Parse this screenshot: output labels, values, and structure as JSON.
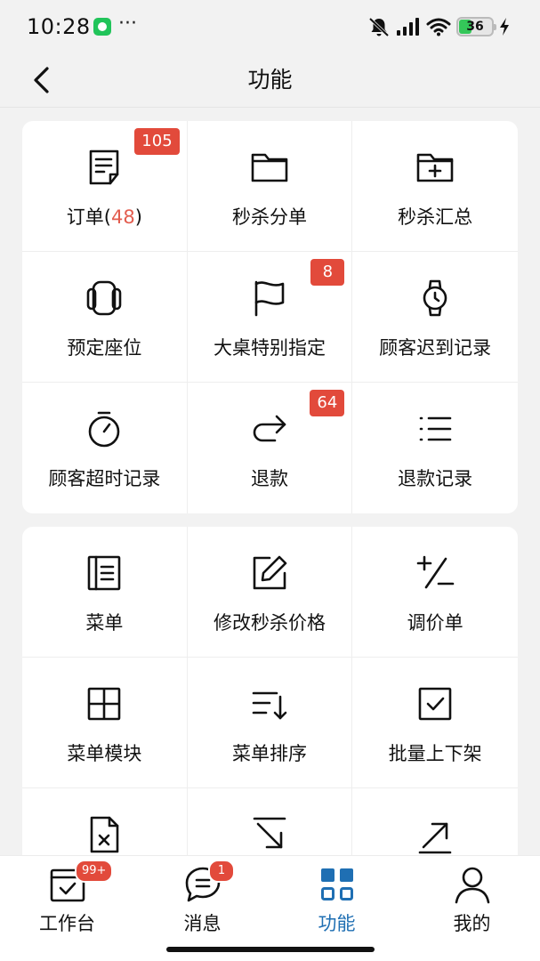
{
  "status_bar": {
    "time": "10:28",
    "dots": "···",
    "battery_level": "36",
    "icons": [
      "chat-app-icon",
      "bell-muted-icon",
      "signal-icon",
      "wifi-icon",
      "battery-icon",
      "charging-icon"
    ]
  },
  "nav": {
    "title": "功能",
    "back_icon": "chevron-left-icon"
  },
  "section1": {
    "items": [
      {
        "label": "订单(",
        "count": "48",
        "suffix": ")",
        "badge": "105",
        "icon": "order-note-icon"
      },
      {
        "label": "秒杀分单",
        "icon": "folder-icon"
      },
      {
        "label": "秒杀汇总",
        "icon": "folder-plus-icon"
      },
      {
        "label": "预定座位",
        "icon": "seat-icon"
      },
      {
        "label": "大桌特别指定",
        "badge": "8",
        "icon": "flag-icon"
      },
      {
        "label": "顾客迟到记录",
        "icon": "watch-icon"
      },
      {
        "label": "顾客超时记录",
        "icon": "stopwatch-icon"
      },
      {
        "label": "退款",
        "badge": "64",
        "icon": "redo-arrow-icon"
      },
      {
        "label": "退款记录",
        "icon": "list-icon"
      }
    ]
  },
  "section2": {
    "items": [
      {
        "label": "菜单",
        "icon": "menu-book-icon"
      },
      {
        "label": "修改秒杀价格",
        "icon": "edit-icon"
      },
      {
        "label": "调价单",
        "icon": "plus-minus-icon"
      },
      {
        "label": "菜单模块",
        "icon": "grid-icon"
      },
      {
        "label": "菜单排序",
        "icon": "sort-icon"
      },
      {
        "label": "批量上下架",
        "icon": "checkbox-icon"
      },
      {
        "label": "",
        "icon": "file-x-icon"
      },
      {
        "label": "",
        "icon": "arrow-down-right-icon"
      },
      {
        "label": "",
        "icon": "arrow-up-right-icon"
      }
    ]
  },
  "tabbar": {
    "tabs": [
      {
        "label": "工作台",
        "badge": "99+",
        "icon": "workbench-icon"
      },
      {
        "label": "消息",
        "badge": "1",
        "icon": "message-icon"
      },
      {
        "label": "功能",
        "icon": "function-grid-icon",
        "active": true
      },
      {
        "label": "我的",
        "icon": "user-icon"
      }
    ],
    "active_color": "#1f6fb3",
    "badge_color": "#e24a3b"
  }
}
